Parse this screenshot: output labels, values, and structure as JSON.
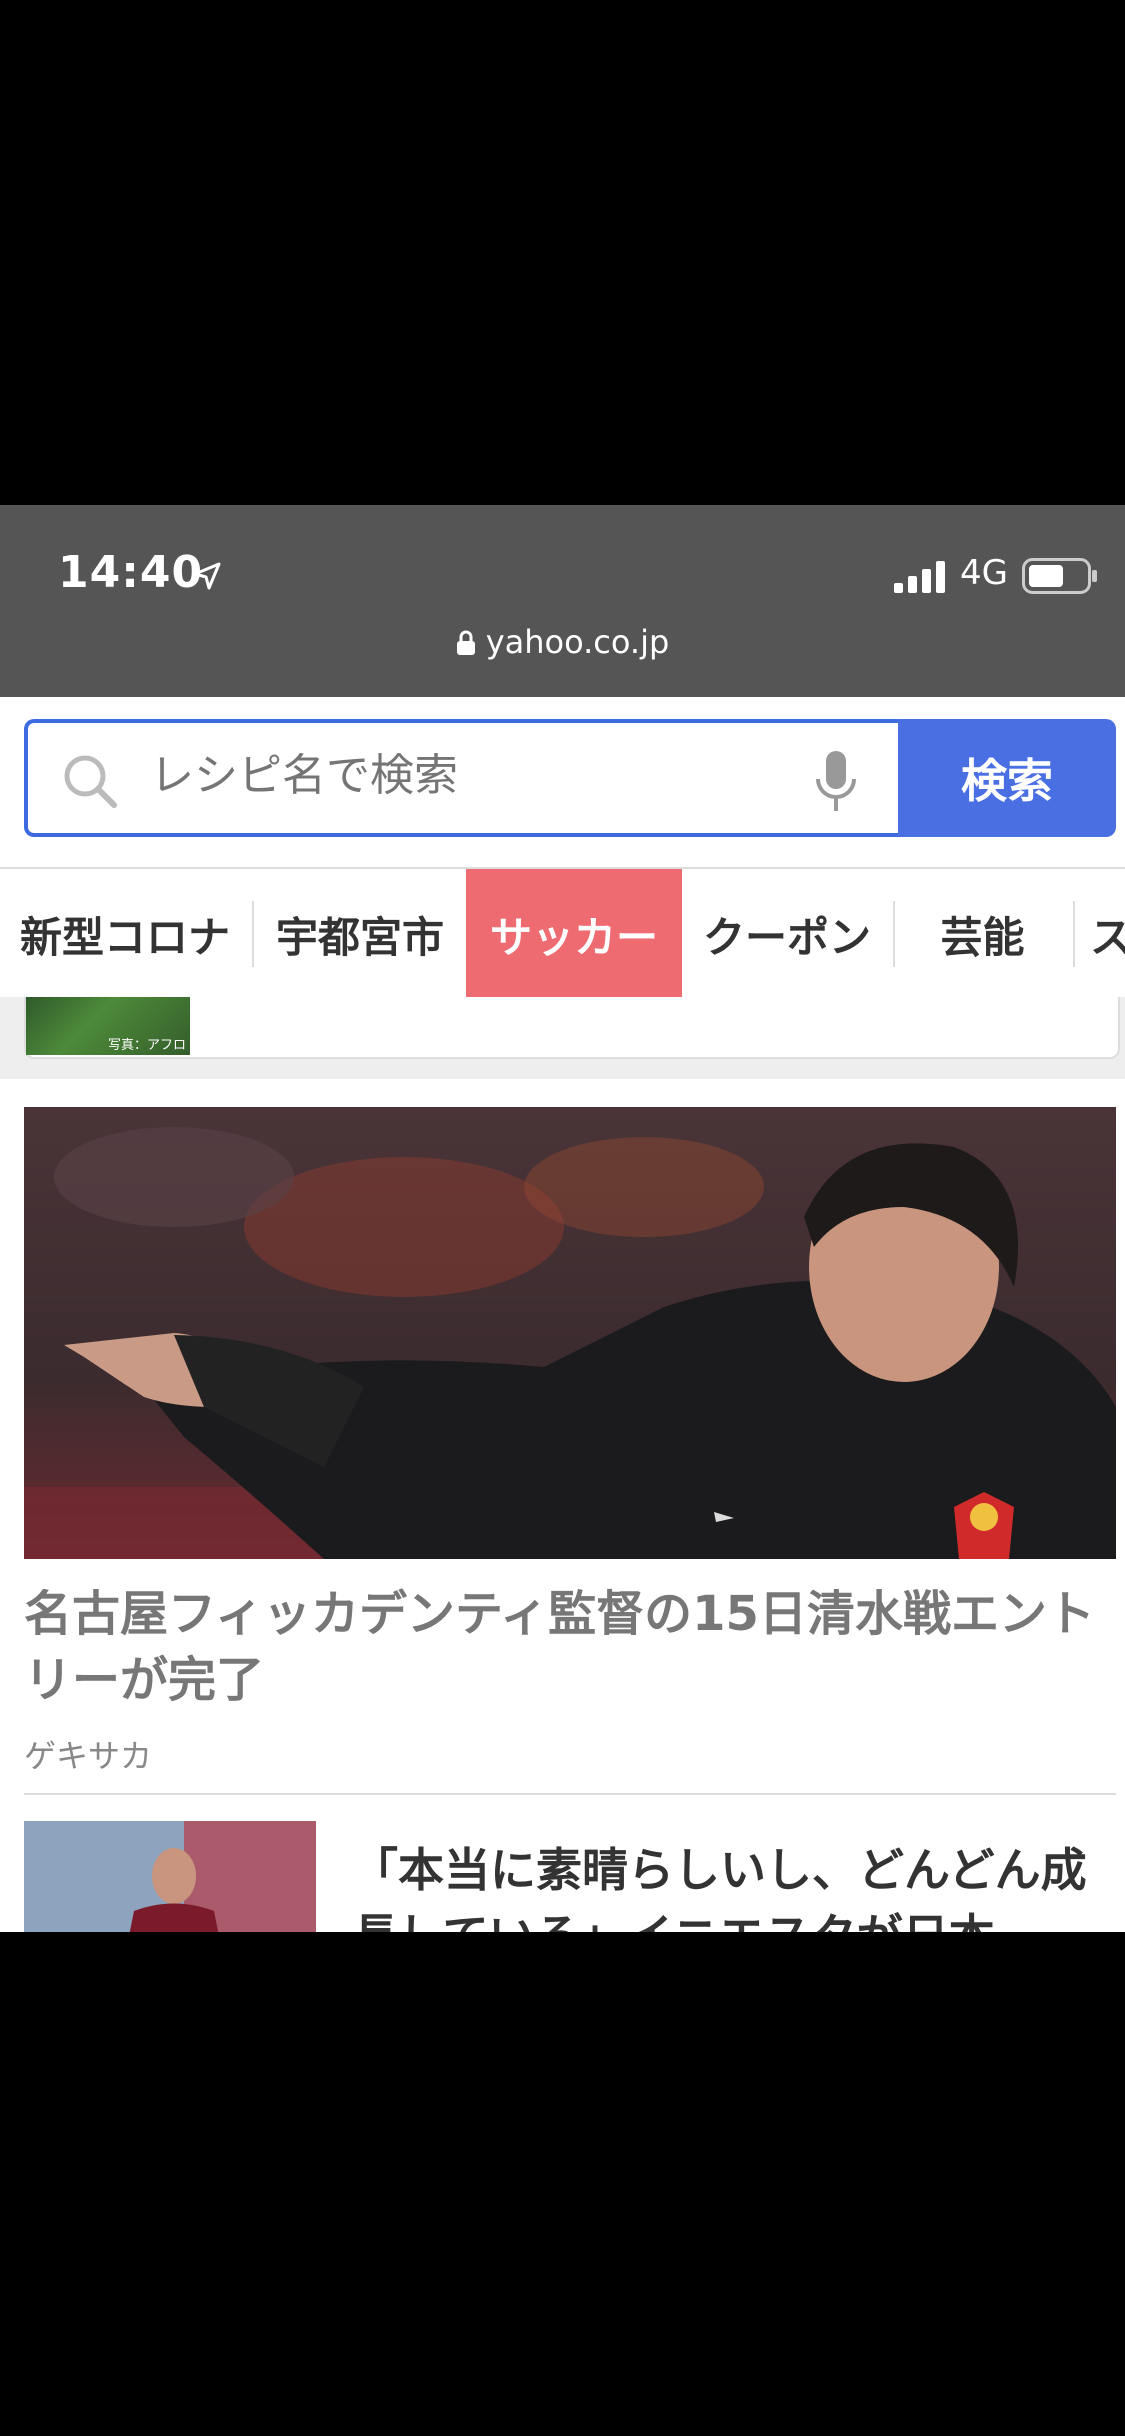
{
  "status_bar": {
    "time": "14:40",
    "network": "4G"
  },
  "browser": {
    "url": "yahoo.co.jp"
  },
  "search": {
    "placeholder": "レシピ名で検索",
    "button_label": "検索"
  },
  "tabs": [
    {
      "label": "新型コロナ"
    },
    {
      "label": "宇都宮市"
    },
    {
      "label": "サッカー",
      "active": true
    },
    {
      "label": "クーポン"
    },
    {
      "label": "芸能"
    },
    {
      "label": "ス"
    }
  ],
  "prev_card": {
    "photo_credit": "写真：アフロ"
  },
  "article": {
    "headline": "名古屋フィッカデンティ監督の15日清水戦エントリーが完了",
    "source": "ゲキサカ"
  },
  "next_article": {
    "title": "「本当に素晴らしいし、どんどん成長している」イニエスタが日本"
  },
  "colors": {
    "accent": "#4a6fe3",
    "active_tab": "#ee6b72",
    "chrome": "#555555"
  }
}
